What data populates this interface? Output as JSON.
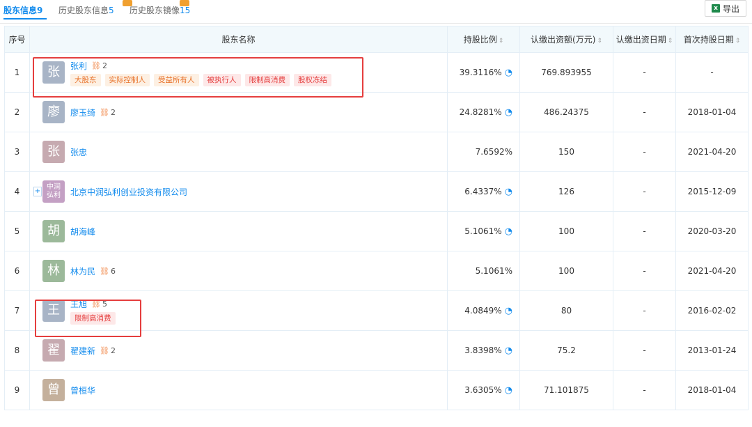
{
  "tabs": [
    {
      "label": "股东信息",
      "count": "9",
      "active": true
    },
    {
      "label": "历史股东信息",
      "count": "5",
      "active": false
    },
    {
      "label": "历史股东镜像",
      "count": "15",
      "active": false
    }
  ],
  "export_label": "导出",
  "export_icon": "excel-icon",
  "columns": {
    "idx": "序号",
    "name": "股东名称",
    "ratio": "持股比例",
    "capital": "认缴出资额(万元)",
    "capital_date": "认缴出资日期",
    "first_date": "首次持股日期"
  },
  "rows": [
    {
      "idx": "1",
      "avatar": "张",
      "avatar_color": "#a8b4c6",
      "name": "张利",
      "rel": "2",
      "tags": [
        {
          "text": "大股东",
          "style": "orange"
        },
        {
          "text": "实际控制人",
          "style": "orange"
        },
        {
          "text": "受益所有人",
          "style": "orange"
        },
        {
          "text": "被执行人",
          "style": "red"
        },
        {
          "text": "限制高消费",
          "style": "red"
        },
        {
          "text": "股权冻结",
          "style": "red"
        }
      ],
      "ratio": "39.3116%",
      "chart": true,
      "capital": "769.893955",
      "capital_date": "-",
      "first_date": "-"
    },
    {
      "idx": "2",
      "avatar": "廖",
      "avatar_color": "#a8b4c6",
      "name": "廖玉绮",
      "rel": "2",
      "tags": [],
      "ratio": "24.8281%",
      "chart": true,
      "capital": "486.24375",
      "capital_date": "-",
      "first_date": "2018-01-04"
    },
    {
      "idx": "3",
      "avatar": "张",
      "avatar_color": "#c6aab0",
      "name": "张忠",
      "rel": "",
      "tags": [],
      "ratio": "7.6592%",
      "chart": false,
      "capital": "150",
      "capital_date": "-",
      "first_date": "2021-04-20"
    },
    {
      "idx": "4",
      "avatar": "中润弘利",
      "avatar_color": "#c4a0c4",
      "name": "北京中润弘利创业投资有限公司",
      "rel": "",
      "tags": [],
      "ratio": "6.4337%",
      "chart": true,
      "capital": "126",
      "capital_date": "-",
      "first_date": "2015-12-09",
      "expand": true
    },
    {
      "idx": "5",
      "avatar": "胡",
      "avatar_color": "#9cb99a",
      "name": "胡海峰",
      "rel": "",
      "tags": [],
      "ratio": "5.1061%",
      "chart": true,
      "capital": "100",
      "capital_date": "-",
      "first_date": "2020-03-20"
    },
    {
      "idx": "6",
      "avatar": "林",
      "avatar_color": "#9cb99a",
      "name": "林为民",
      "rel": "6",
      "tags": [],
      "ratio": "5.1061%",
      "chart": false,
      "capital": "100",
      "capital_date": "-",
      "first_date": "2021-04-20"
    },
    {
      "idx": "7",
      "avatar": "王",
      "avatar_color": "#a8b4c6",
      "name": "王旭",
      "rel": "5",
      "tags": [
        {
          "text": "限制高消费",
          "style": "red"
        }
      ],
      "ratio": "4.0849%",
      "chart": true,
      "capital": "80",
      "capital_date": "-",
      "first_date": "2016-02-02"
    },
    {
      "idx": "8",
      "avatar": "翟",
      "avatar_color": "#c6aab0",
      "name": "翟建新",
      "rel": "2",
      "tags": [],
      "ratio": "3.8398%",
      "chart": true,
      "capital": "75.2",
      "capital_date": "-",
      "first_date": "2013-01-24"
    },
    {
      "idx": "9",
      "avatar": "曾",
      "avatar_color": "#c4b09c",
      "name": "曾桓华",
      "rel": "",
      "tags": [],
      "ratio": "3.6305%",
      "chart": true,
      "capital": "71.101875",
      "capital_date": "-",
      "first_date": "2018-01-04"
    }
  ],
  "colors": {
    "accent": "#128bed",
    "header_bg": "#f2f9fc",
    "highlight": "#e53e3e",
    "tag_orange": "#e8722a",
    "tag_red": "#e53e3e"
  }
}
